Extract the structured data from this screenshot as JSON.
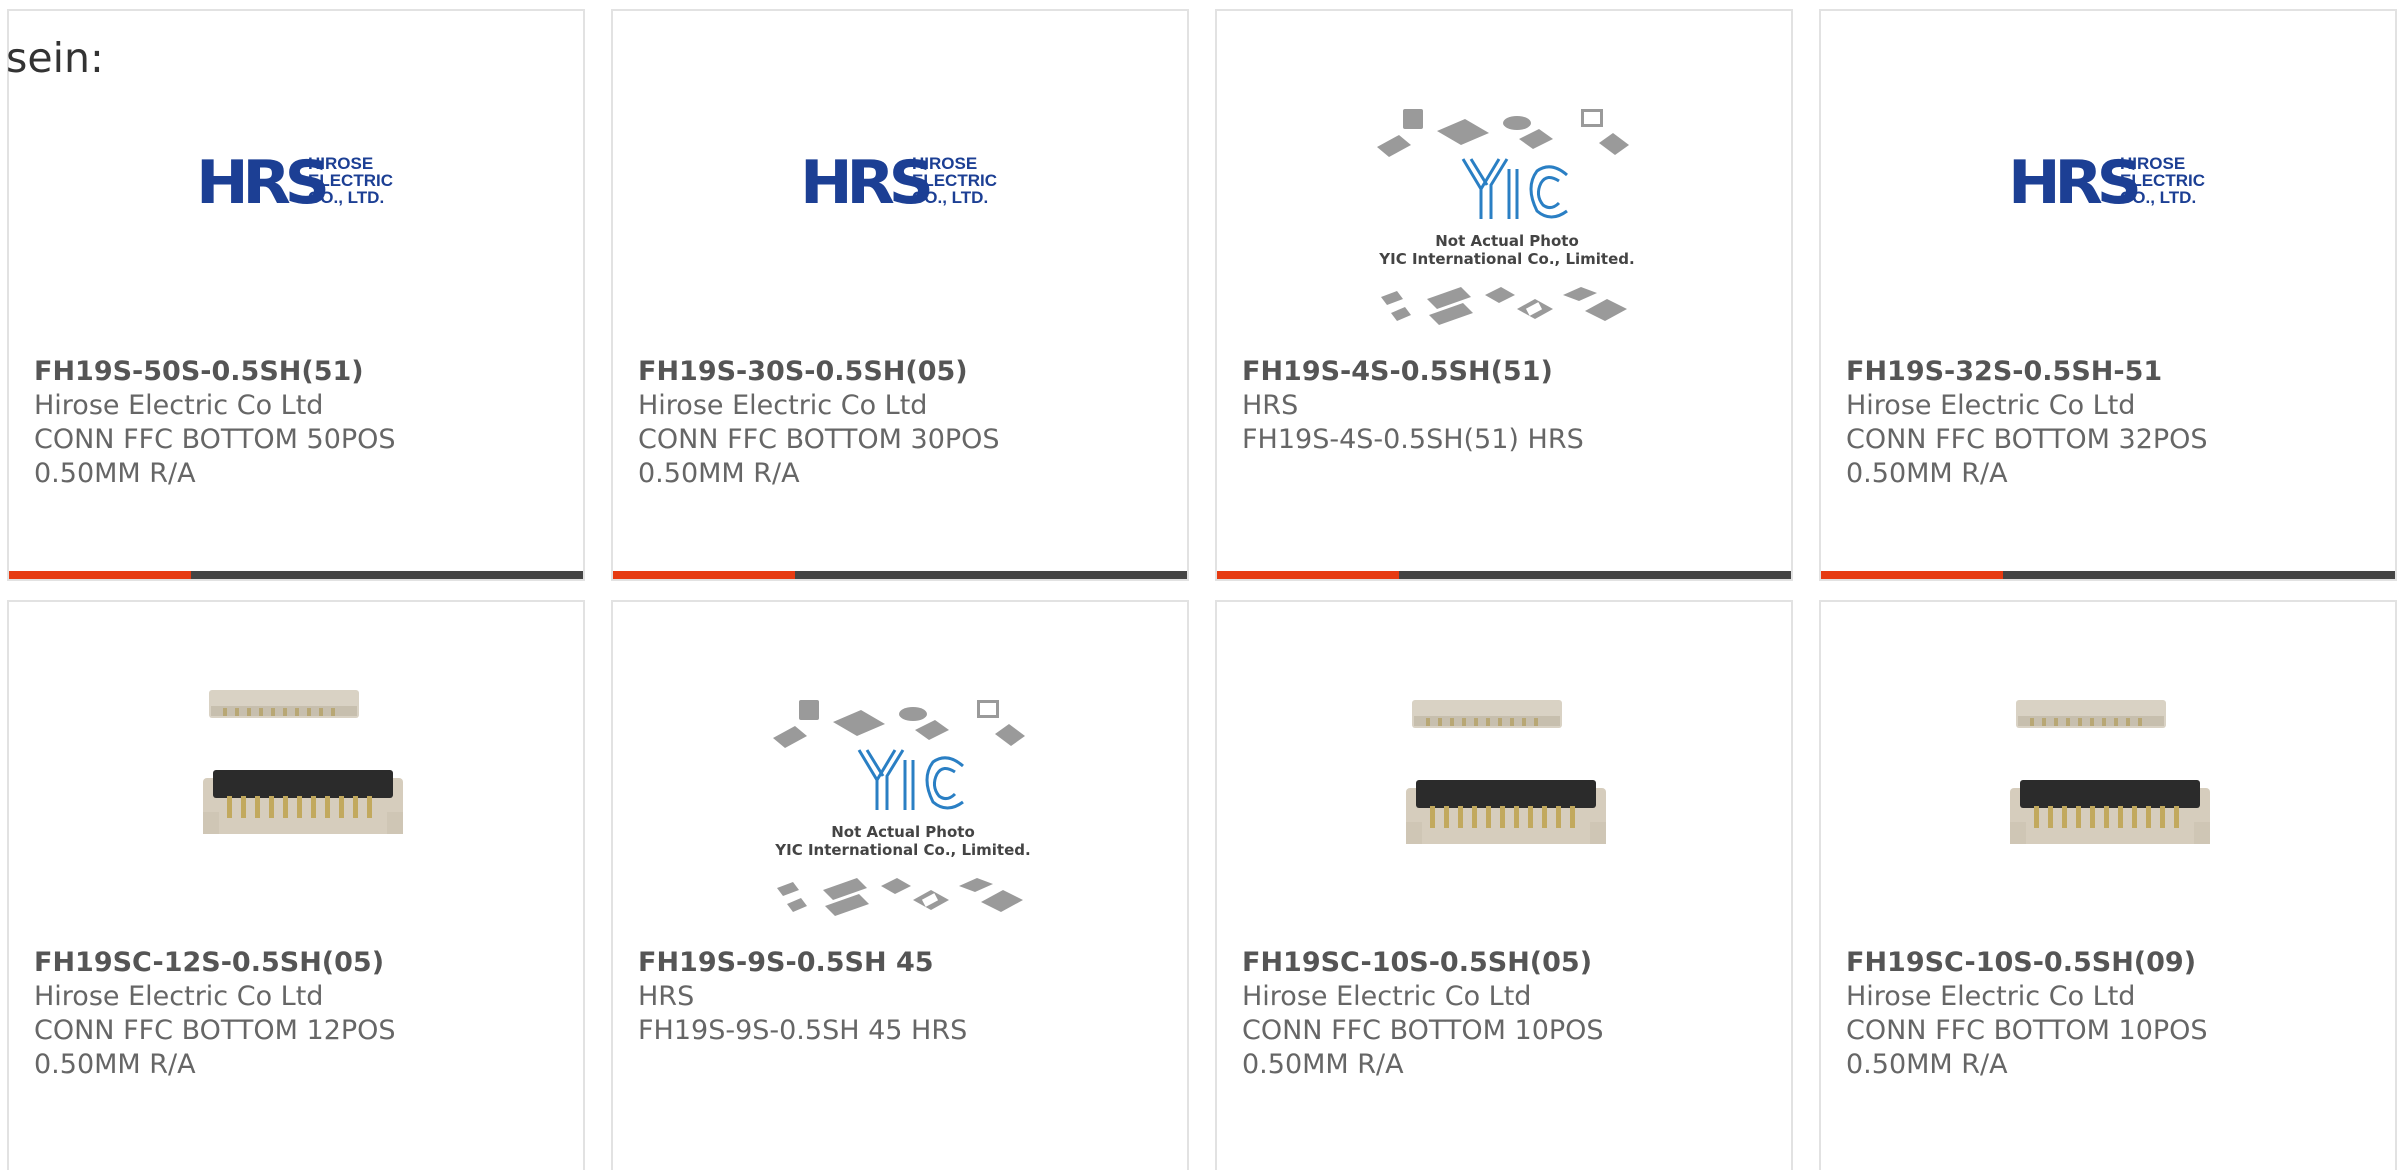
{
  "lead_text": "sein:",
  "logos": {
    "hrs_mark": "HRS",
    "hrs_line1": "HIROSE",
    "hrs_line2": "ELECTRIC",
    "hrs_line3": "CO., LTD.",
    "yic_mark": "YIC",
    "yic_caption1": "Not Actual Photo",
    "yic_caption2": "YIC International Co., Limited."
  },
  "products": [
    {
      "part_number": "FH19S-50S-0.5SH(51)",
      "manufacturer": "Hirose Electric Co Ltd",
      "description_line1": "CONN FFC BOTTOM 50POS",
      "description_line2": "0.50MM R/A",
      "image": "hrs-logo"
    },
    {
      "part_number": "FH19S-30S-0.5SH(05)",
      "manufacturer": "Hirose Electric Co Ltd",
      "description_line1": "CONN FFC BOTTOM 30POS",
      "description_line2": "0.50MM R/A",
      "image": "hrs-logo"
    },
    {
      "part_number": "FH19S-4S-0.5SH(51)",
      "manufacturer": "HRS",
      "description_line1": "FH19S-4S-0.5SH(51) HRS",
      "description_line2": "",
      "image": "yic-placeholder"
    },
    {
      "part_number": "FH19S-32S-0.5SH-51",
      "manufacturer": "Hirose Electric Co Ltd",
      "description_line1": "CONN FFC BOTTOM 32POS",
      "description_line2": "0.50MM R/A",
      "image": "hrs-logo"
    },
    {
      "part_number": "FH19SC-12S-0.5SH(05)",
      "manufacturer": "Hirose Electric Co Ltd",
      "description_line1": "CONN FFC BOTTOM 12POS",
      "description_line2": "0.50MM R/A",
      "image": "connector-photo"
    },
    {
      "part_number": "FH19S-9S-0.5SH 45",
      "manufacturer": "HRS",
      "description_line1": "FH19S-9S-0.5SH 45 HRS",
      "description_line2": "",
      "image": "yic-placeholder"
    },
    {
      "part_number": "FH19SC-10S-0.5SH(05)",
      "manufacturer": "Hirose Electric Co Ltd",
      "description_line1": "CONN FFC BOTTOM 10POS",
      "description_line2": "0.50MM R/A",
      "image": "connector-photo"
    },
    {
      "part_number": "FH19SC-10S-0.5SH(09)",
      "manufacturer": "Hirose Electric Co Ltd",
      "description_line1": "CONN FFC BOTTOM 10POS",
      "description_line2": "0.50MM R/A",
      "image": "connector-photo"
    }
  ],
  "colors": {
    "accent": "#e63b12",
    "bar": "#444444",
    "card_border": "#e2e2e2",
    "hrs_blue": "#1c3f94",
    "yic_blue": "#2a7fc4"
  }
}
